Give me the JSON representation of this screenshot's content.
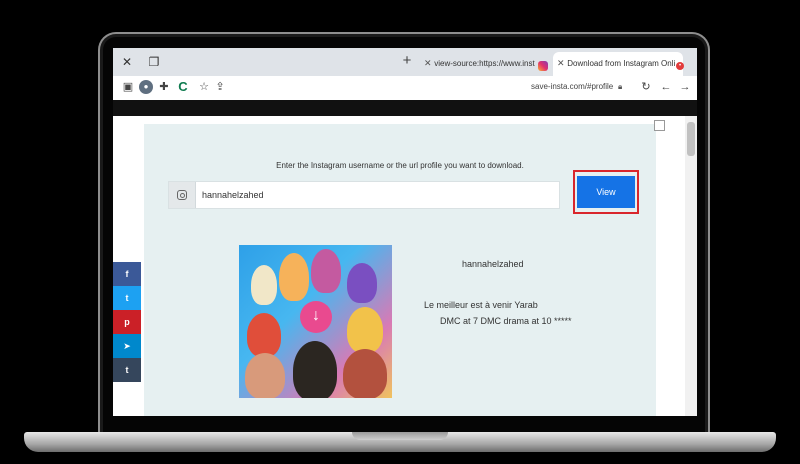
{
  "browser": {
    "tabs": [
      {
        "label": "view-source:https://www.instagr",
        "active": false
      },
      {
        "label": "Download from Instagram Onli",
        "active": true
      }
    ],
    "new_tab_symbol": "+",
    "url": "save-insta.com/#profile"
  },
  "page": {
    "prompt": "Enter the Instagram username or the url profile you want to download.",
    "search_value": "hannahelzahed",
    "view_label": "View",
    "profile": {
      "username": "hannahelzahed",
      "bio_line1": "Le meilleur est à venir Yarab",
      "bio_line2": "DMC at 7 DMC drama at 10 *****"
    },
    "share_buttons": [
      {
        "label": "f",
        "name": "facebook",
        "color": "#3b5998"
      },
      {
        "label": "t",
        "name": "twitter",
        "color": "#1da1f2"
      },
      {
        "label": "p",
        "name": "pinterest",
        "color": "#cb2027"
      },
      {
        "label": "➤",
        "name": "telegram",
        "color": "#0088cc"
      },
      {
        "label": "t",
        "name": "tumblr",
        "color": "#35465c"
      }
    ]
  },
  "colors": {
    "accent_button": "#1573e6",
    "highlight_outline": "#d9262c",
    "panel_bg": "#e6f0f1"
  }
}
